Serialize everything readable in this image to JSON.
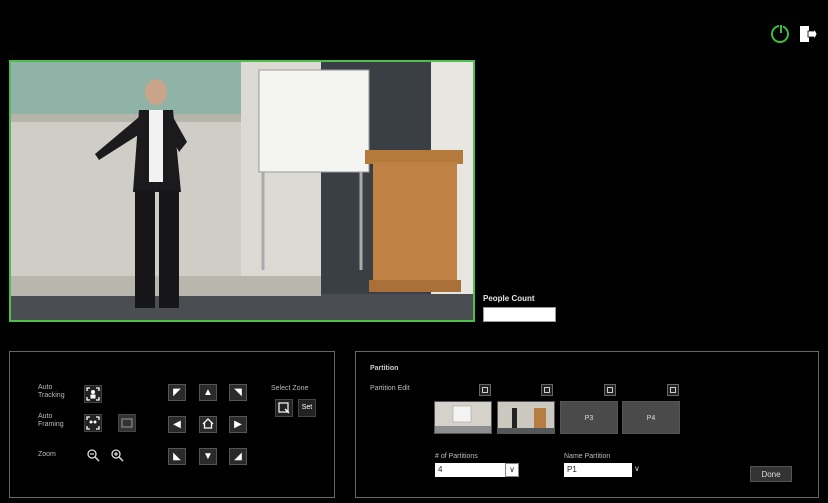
{
  "header": {
    "power_icon": "power-icon",
    "logout_icon": "logout-icon",
    "accent": "#3bbf3b"
  },
  "video": {
    "border_color": "#4dbf4d"
  },
  "people_count": {
    "label": "People Count",
    "value": ""
  },
  "controls": {
    "auto_tracking_label": "Auto Tracking",
    "auto_framing_label": "Auto Framing",
    "zoom_label": "Zoom",
    "select_zone_label": "Select Zone",
    "set_label": "Set",
    "home_icon": "home-icon"
  },
  "partition": {
    "title": "Partition",
    "edit_label": "Partition Edit",
    "thumbs": [
      {
        "label": ""
      },
      {
        "label": ""
      },
      {
        "label": "P3"
      },
      {
        "label": "P4"
      }
    ],
    "count_label": "# of Partitions",
    "count_value": "4",
    "name_label": "Name Partition",
    "name_value": "P1",
    "done_label": "Done"
  }
}
